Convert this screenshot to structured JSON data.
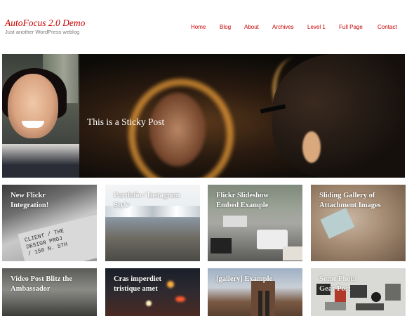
{
  "site": {
    "title": "AutoFocus 2.0 Demo",
    "description": "Just another WordPress weblog"
  },
  "nav": {
    "items": [
      {
        "label": "Home"
      },
      {
        "label": "Blog"
      },
      {
        "label": "About"
      },
      {
        "label": "Archives"
      },
      {
        "label": "Level 1"
      },
      {
        "label": "Full Page"
      },
      {
        "label": "Contact"
      }
    ]
  },
  "featured": {
    "title": "This is a Sticky Post"
  },
  "posts": [
    {
      "title_line1": "New Flickr",
      "title_line2": "Integration!"
    },
    {
      "title_line1": "Portfolio / Instagram",
      "title_line2": "Style"
    },
    {
      "title_line1": "Flickr Slideshow",
      "title_line2": "Embed Example"
    },
    {
      "title_line1": "Sliding Gallery of",
      "title_line2": "Attachment Images"
    },
    {
      "title_line1": "Video Post Blitz the",
      "title_line2": "Ambassador"
    },
    {
      "title_line1": "Cras imperdiet",
      "title_line2": "tristique amet"
    },
    {
      "title_line1": "[gallery] Example",
      "title_line2": ""
    },
    {
      "title_line1": "Some Photo",
      "title_line2": "Gear Post"
    }
  ],
  "colors": {
    "accent": "#cc0000",
    "description_gray": "#777777"
  }
}
